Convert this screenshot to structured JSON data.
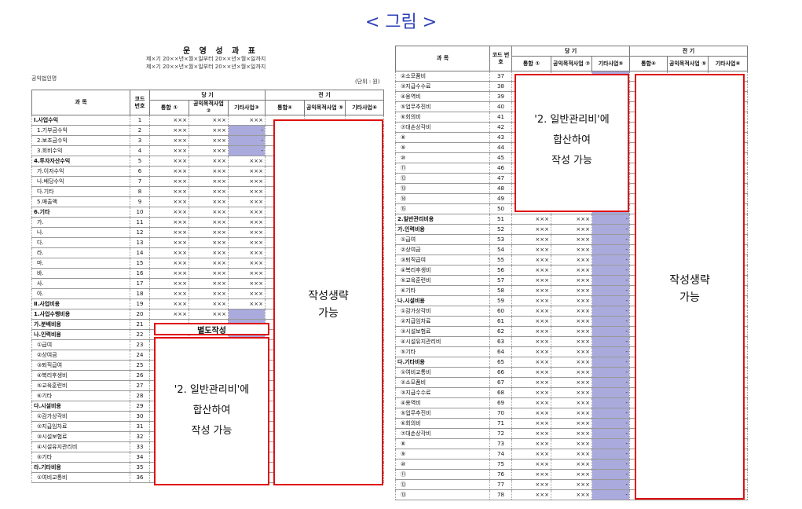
{
  "figure_title": "< 그림 >",
  "left": {
    "title": "운 영 성 과 표",
    "period1": "제×기 20××년×월×일부터 20××년×월×일까지",
    "period2": "제×기 20××년×월×일부터 20××년×월×일까지",
    "org": "공익법인명",
    "unit": "(단위 : 원)",
    "headers": {
      "subject": "과 목",
      "code": "코드 번호",
      "current": "당 기",
      "prior": "전 기",
      "c1": "통합 ①",
      "c2": "공익목적사업 ②",
      "c3": "기타사업③",
      "c4": "통합④",
      "c5": "공익목적사업 ⑤",
      "c6": "기타사업⑥"
    },
    "rows": [
      {
        "s": "Ⅰ.사업수익",
        "c": "1",
        "v": [
          "×××",
          "×××",
          "×××"
        ],
        "b": true
      },
      {
        "s": "1.기부금수익",
        "c": "2",
        "v": [
          "×××",
          "×××",
          "-"
        ]
      },
      {
        "s": "2.보조금수익",
        "c": "3",
        "v": [
          "×××",
          "×××",
          "-"
        ]
      },
      {
        "s": "3.회비수익",
        "c": "4",
        "v": [
          "×××",
          "×××",
          "-"
        ]
      },
      {
        "s": "4.투자자산수익",
        "c": "5",
        "v": [
          "×××",
          "×××",
          "×××"
        ],
        "b": true
      },
      {
        "s": "가.이자수익",
        "c": "6",
        "v": [
          "×××",
          "×××",
          "×××"
        ]
      },
      {
        "s": "나.배당수익",
        "c": "7",
        "v": [
          "×××",
          "×××",
          "×××"
        ]
      },
      {
        "s": "다.기타",
        "c": "8",
        "v": [
          "×××",
          "×××",
          "×××"
        ]
      },
      {
        "s": "5.매출액",
        "c": "9",
        "v": [
          "×××",
          "×××",
          "×××"
        ]
      },
      {
        "s": "6.기타",
        "c": "10",
        "v": [
          "×××",
          "×××",
          "×××"
        ],
        "b": true
      },
      {
        "s": "가.",
        "c": "11",
        "v": [
          "×××",
          "×××",
          "×××"
        ]
      },
      {
        "s": "나.",
        "c": "12",
        "v": [
          "×××",
          "×××",
          "×××"
        ]
      },
      {
        "s": "다.",
        "c": "13",
        "v": [
          "×××",
          "×××",
          "×××"
        ]
      },
      {
        "s": "라.",
        "c": "14",
        "v": [
          "×××",
          "×××",
          "×××"
        ]
      },
      {
        "s": "마.",
        "c": "15",
        "v": [
          "×××",
          "×××",
          "×××"
        ]
      },
      {
        "s": "바.",
        "c": "16",
        "v": [
          "×××",
          "×××",
          "×××"
        ]
      },
      {
        "s": "사.",
        "c": "17",
        "v": [
          "×××",
          "×××",
          "×××"
        ]
      },
      {
        "s": "아.",
        "c": "18",
        "v": [
          "×××",
          "×××",
          "×××"
        ]
      },
      {
        "s": "Ⅱ.사업비용",
        "c": "19",
        "v": [
          "×××",
          "×××",
          "×××"
        ],
        "b": true
      },
      {
        "s": "1.사업수행비용",
        "c": "20",
        "v": [
          "×××",
          "×××",
          ""
        ],
        "b": true
      },
      {
        "s": "가.분배비용",
        "c": "21",
        "v": [
          "",
          "",
          ""
        ],
        "b": true
      },
      {
        "s": "나.인력비용",
        "c": "22",
        "v": [
          "",
          "",
          ""
        ],
        "b": true
      },
      {
        "s": "①급여",
        "c": "23",
        "v": [
          "",
          "",
          ""
        ]
      },
      {
        "s": "②상여금",
        "c": "24",
        "v": [
          "",
          "",
          ""
        ]
      },
      {
        "s": "③퇴직급여",
        "c": "25",
        "v": [
          "",
          "",
          ""
        ]
      },
      {
        "s": "④복리후생비",
        "c": "26",
        "v": [
          "",
          "",
          ""
        ]
      },
      {
        "s": "⑤교육훈련비",
        "c": "27",
        "v": [
          "",
          "",
          ""
        ]
      },
      {
        "s": "⑥기타",
        "c": "28",
        "v": [
          "",
          "",
          ""
        ]
      },
      {
        "s": "다.시설비용",
        "c": "29",
        "v": [
          "",
          "",
          ""
        ],
        "b": true
      },
      {
        "s": "①감가상각비",
        "c": "30",
        "v": [
          "",
          "",
          ""
        ]
      },
      {
        "s": "②지급임차료",
        "c": "31",
        "v": [
          "",
          "",
          ""
        ]
      },
      {
        "s": "③시설보험료",
        "c": "32",
        "v": [
          "",
          "",
          ""
        ]
      },
      {
        "s": "④시설유지관리비",
        "c": "33",
        "v": [
          "",
          "",
          ""
        ]
      },
      {
        "s": "⑤기타",
        "c": "34",
        "v": [
          "",
          "",
          ""
        ]
      },
      {
        "s": "라.기타비용",
        "c": "35",
        "v": [
          "",
          "",
          ""
        ],
        "b": true
      },
      {
        "s": "①여비교통비",
        "c": "36",
        "v": [
          "",
          "",
          ""
        ]
      }
    ],
    "separate_label": "별도작성",
    "merge_text": [
      "'2. 일반관리비'에",
      "합산하여",
      "작성 가능"
    ],
    "omit_text": [
      "작성생략",
      "가능"
    ]
  },
  "right": {
    "headers": {
      "subject": "과 목",
      "code": "코드 번호",
      "current": "당 기",
      "prior": "전 기",
      "c1": "통합 ①",
      "c2": "공익목적사업 ②",
      "c3": "기타사업⑤",
      "c4": "통합④",
      "c5": "공익목적사업 ⑤",
      "c6": "기타사업⑥"
    },
    "rows": [
      {
        "s": "②소모품비",
        "c": "37",
        "v": [
          "",
          "",
          ""
        ]
      },
      {
        "s": "③지급수수료",
        "c": "38",
        "v": [
          "",
          "",
          ""
        ]
      },
      {
        "s": "④용역비",
        "c": "39",
        "v": [
          "",
          "",
          ""
        ]
      },
      {
        "s": "⑤업무추진비",
        "c": "40",
        "v": [
          "",
          "",
          ""
        ]
      },
      {
        "s": "⑥회의비",
        "c": "41",
        "v": [
          "",
          "",
          ""
        ]
      },
      {
        "s": "⑦대손상각비",
        "c": "42",
        "v": [
          "",
          "",
          ""
        ]
      },
      {
        "s": "⑧",
        "c": "43",
        "v": [
          "",
          "",
          ""
        ]
      },
      {
        "s": "⑨",
        "c": "44",
        "v": [
          "",
          "",
          ""
        ]
      },
      {
        "s": "⑩",
        "c": "45",
        "v": [
          "",
          "",
          ""
        ]
      },
      {
        "s": "⑪",
        "c": "46",
        "v": [
          "",
          "",
          ""
        ]
      },
      {
        "s": "⑫",
        "c": "47",
        "v": [
          "",
          "",
          ""
        ]
      },
      {
        "s": "⑬",
        "c": "48",
        "v": [
          "",
          "",
          ""
        ]
      },
      {
        "s": "⑭",
        "c": "49",
        "v": [
          "",
          "",
          ""
        ]
      },
      {
        "s": "⑮",
        "c": "50",
        "v": [
          "",
          "",
          ""
        ]
      },
      {
        "s": "2.일반관리비용",
        "c": "51",
        "v": [
          "×××",
          "×××",
          "-"
        ],
        "b": true
      },
      {
        "s": "가.인력비용",
        "c": "52",
        "v": [
          "×××",
          "×××",
          "-"
        ],
        "b": true
      },
      {
        "s": "①급여",
        "c": "53",
        "v": [
          "×××",
          "×××",
          "-"
        ]
      },
      {
        "s": "②상여금",
        "c": "54",
        "v": [
          "×××",
          "×××",
          "-"
        ]
      },
      {
        "s": "③퇴직급여",
        "c": "55",
        "v": [
          "×××",
          "×××",
          "-"
        ]
      },
      {
        "s": "④복리후생비",
        "c": "56",
        "v": [
          "×××",
          "×××",
          "-"
        ]
      },
      {
        "s": "⑤교육훈련비",
        "c": "57",
        "v": [
          "×××",
          "×××",
          "-"
        ]
      },
      {
        "s": "⑥기타",
        "c": "58",
        "v": [
          "×××",
          "×××",
          "-"
        ]
      },
      {
        "s": "나.시설비용",
        "c": "59",
        "v": [
          "×××",
          "×××",
          "-"
        ],
        "b": true
      },
      {
        "s": "①감가상각비",
        "c": "60",
        "v": [
          "×××",
          "×××",
          "-"
        ]
      },
      {
        "s": "②지급임차료",
        "c": "61",
        "v": [
          "×××",
          "×××",
          "-"
        ]
      },
      {
        "s": "③시설보험료",
        "c": "62",
        "v": [
          "×××",
          "×××",
          "-"
        ]
      },
      {
        "s": "④시설유지관리비",
        "c": "63",
        "v": [
          "×××",
          "×××",
          "-"
        ]
      },
      {
        "s": "⑤기타",
        "c": "64",
        "v": [
          "×××",
          "×××",
          "-"
        ]
      },
      {
        "s": "다.기타비용",
        "c": "65",
        "v": [
          "×××",
          "×××",
          "-"
        ],
        "b": true
      },
      {
        "s": "①여비교통비",
        "c": "66",
        "v": [
          "×××",
          "×××",
          "-"
        ]
      },
      {
        "s": "②소모품비",
        "c": "67",
        "v": [
          "×××",
          "×××",
          "-"
        ]
      },
      {
        "s": "③지급수수료",
        "c": "68",
        "v": [
          "×××",
          "×××",
          "-"
        ]
      },
      {
        "s": "④용역비",
        "c": "69",
        "v": [
          "×××",
          "×××",
          "-"
        ]
      },
      {
        "s": "⑤업무추진비",
        "c": "70",
        "v": [
          "×××",
          "×××",
          "-"
        ]
      },
      {
        "s": "⑥회의비",
        "c": "71",
        "v": [
          "×××",
          "×××",
          "-"
        ]
      },
      {
        "s": "⑦대손상각비",
        "c": "72",
        "v": [
          "×××",
          "×××",
          "-"
        ]
      },
      {
        "s": "⑧",
        "c": "73",
        "v": [
          "×××",
          "×××",
          "-"
        ]
      },
      {
        "s": "⑨",
        "c": "74",
        "v": [
          "×××",
          "×××",
          "-"
        ]
      },
      {
        "s": "⑩",
        "c": "75",
        "v": [
          "×××",
          "×××",
          "-"
        ]
      },
      {
        "s": "⑪",
        "c": "76",
        "v": [
          "×××",
          "×××",
          "-"
        ]
      },
      {
        "s": "⑫",
        "c": "77",
        "v": [
          "×××",
          "×××",
          "-"
        ]
      },
      {
        "s": "⑬",
        "c": "78",
        "v": [
          "×××",
          "×××",
          "-"
        ]
      }
    ],
    "merge_text": [
      "'2. 일반관리비'에",
      "합산하여",
      "작성 가능"
    ],
    "omit_text": [
      "작성생략",
      "가능"
    ]
  }
}
